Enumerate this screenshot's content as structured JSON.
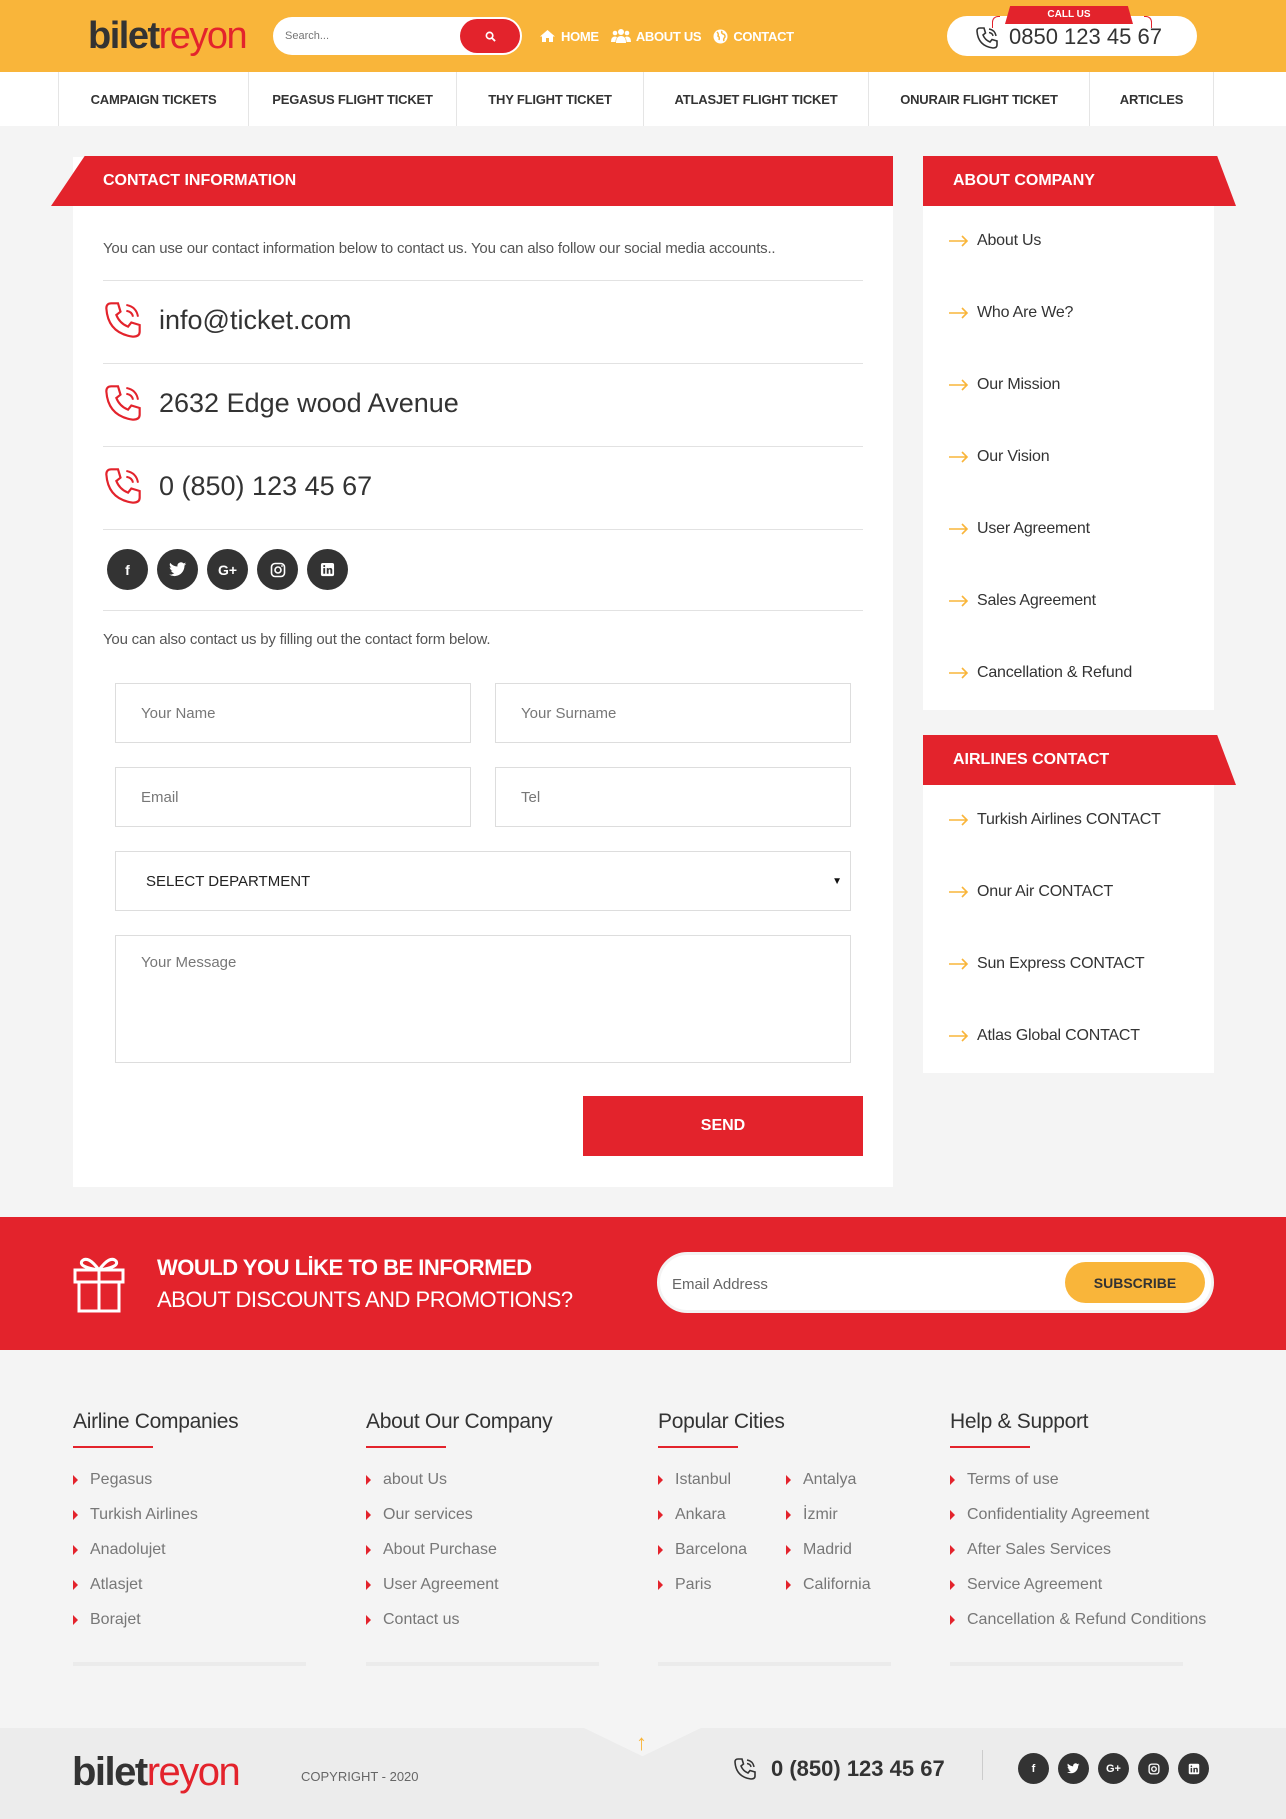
{
  "brand": {
    "logo_left": "bilet",
    "logo_right": "reyon"
  },
  "search": {
    "placeholder": "Search..."
  },
  "topnav": [
    {
      "label": "HOME",
      "icon": "home-icon"
    },
    {
      "label": "ABOUT US",
      "icon": "users-icon"
    },
    {
      "label": "CONTACT",
      "icon": "globe-icon"
    }
  ],
  "call": {
    "label": "CALL US",
    "number": "0850 123 45 67"
  },
  "mainnav": [
    "CAMPAIGN TICKETS",
    "PEGASUS FLIGHT TICKET",
    "THY FLIGHT TICKET",
    "ATLASJET FLIGHT TICKET",
    "ONURAIR FLIGHT TICKET",
    "ARTICLES"
  ],
  "contact": {
    "title": "CONTACT INFORMATION",
    "intro": "You can use our contact information below to contact us. You can also follow our social media accounts..",
    "email": "info@ticket.com",
    "address": "2632 Edge wood Avenue",
    "phone": "0 (850) 123 45 67",
    "socials": [
      "facebook-icon",
      "twitter-icon",
      "google-plus-icon",
      "instagram-icon",
      "linkedin-icon"
    ],
    "form_intro": "You can also contact us by filling out the contact form below.",
    "form": {
      "name": "Your Name",
      "surname": "Your Surname",
      "email": "Email",
      "tel": "Tel",
      "department": "SELECT DEPARTMENT",
      "message": "Your Message",
      "send": "SEND"
    }
  },
  "about_company": {
    "title": "ABOUT COMPANY",
    "items": [
      "About Us",
      "Who Are We?",
      "Our Mission",
      "Our Vision",
      "User Agreement",
      "Sales Agreement",
      "Cancellation & Refund"
    ]
  },
  "airlines_contact": {
    "title": "AIRLINES CONTACT",
    "items": [
      "Turkish Airlines CONTACT",
      "Onur Air CONTACT",
      "Sun Express CONTACT",
      "Atlas Global CONTACT"
    ]
  },
  "promo": {
    "line1": "WOULD YOU LİKE TO BE INFORMED",
    "line2": "ABOUT DISCOUNTS AND PROMOTIONS?",
    "email_placeholder": "Email Address",
    "button": "SUBSCRIBE"
  },
  "footer": {
    "airlines": {
      "title": "Airline Companies",
      "items": [
        "Pegasus",
        "Turkish Airlines",
        "Anadolujet",
        "Atlasjet",
        "Borajet"
      ]
    },
    "company": {
      "title": "About Our Company",
      "items": [
        "about Us",
        "Our services",
        "About Purchase",
        "User Agreement",
        "Contact us"
      ]
    },
    "cities": {
      "title": "Popular Cities",
      "col1": [
        "Istanbul",
        "Ankara",
        "Barcelona",
        "Paris"
      ],
      "col2": [
        "Antalya",
        "İzmir",
        "Madrid",
        "California"
      ]
    },
    "help": {
      "title": "Help & Support",
      "items": [
        "Terms of use",
        "Confidentiality Agreement",
        "After Sales Services",
        "Service Agreement",
        "Cancellation & Refund Conditions"
      ]
    }
  },
  "bottom": {
    "copyright": "COPYRIGHT - 2020",
    "phone": "0 (850) 123 45 67"
  },
  "colors": {
    "yellow": "#f9b53a",
    "red": "#e3232c",
    "dark": "#333333"
  }
}
